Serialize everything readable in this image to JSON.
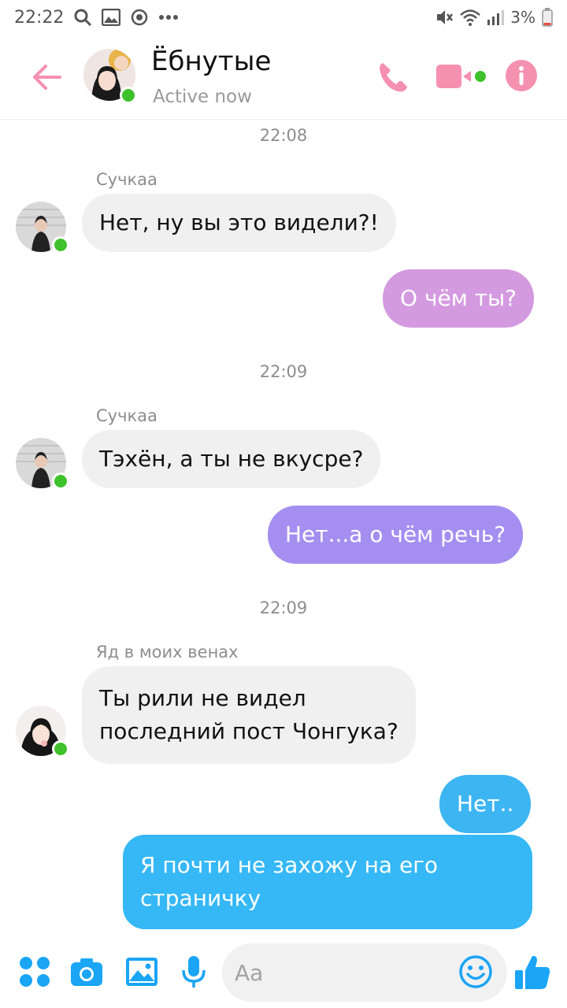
{
  "colors": {
    "accent_pink": "#f590b0",
    "blue": "#1aa5f5",
    "online": "#3ec12b",
    "bubble_in": "#f1f0f0"
  },
  "status_bar": {
    "time": "22:22",
    "battery": "3%",
    "icons": [
      "search-icon",
      "gallery-icon",
      "sync-icon",
      "more-icon",
      "mute-icon",
      "wifi-icon",
      "signal-icon",
      "battery-icon"
    ]
  },
  "header": {
    "title": "Ёбнутые",
    "status": "Active now"
  },
  "messages": {
    "ts1": "22:08",
    "m1_sender": "Сучкаа",
    "m1_text": "Нет, ну вы это видели?!",
    "m2_text": "О чём ты?",
    "ts2": "22:09",
    "m3_sender": "Сучкаа",
    "m3_text": "Тэхён, а ты не вкусре?",
    "m4_text": "Нет...а о чём речь?",
    "ts3": "22:09",
    "m5_sender": "Яд в моих венах",
    "m5_line1": "Ты рили не видел",
    "m5_line2": "последний пост Чонгука?",
    "m6_text": "Нет..",
    "m7_line1": "Я почти не захожу на его",
    "m7_line2": "страничку"
  },
  "composer": {
    "placeholder": "Aa"
  }
}
